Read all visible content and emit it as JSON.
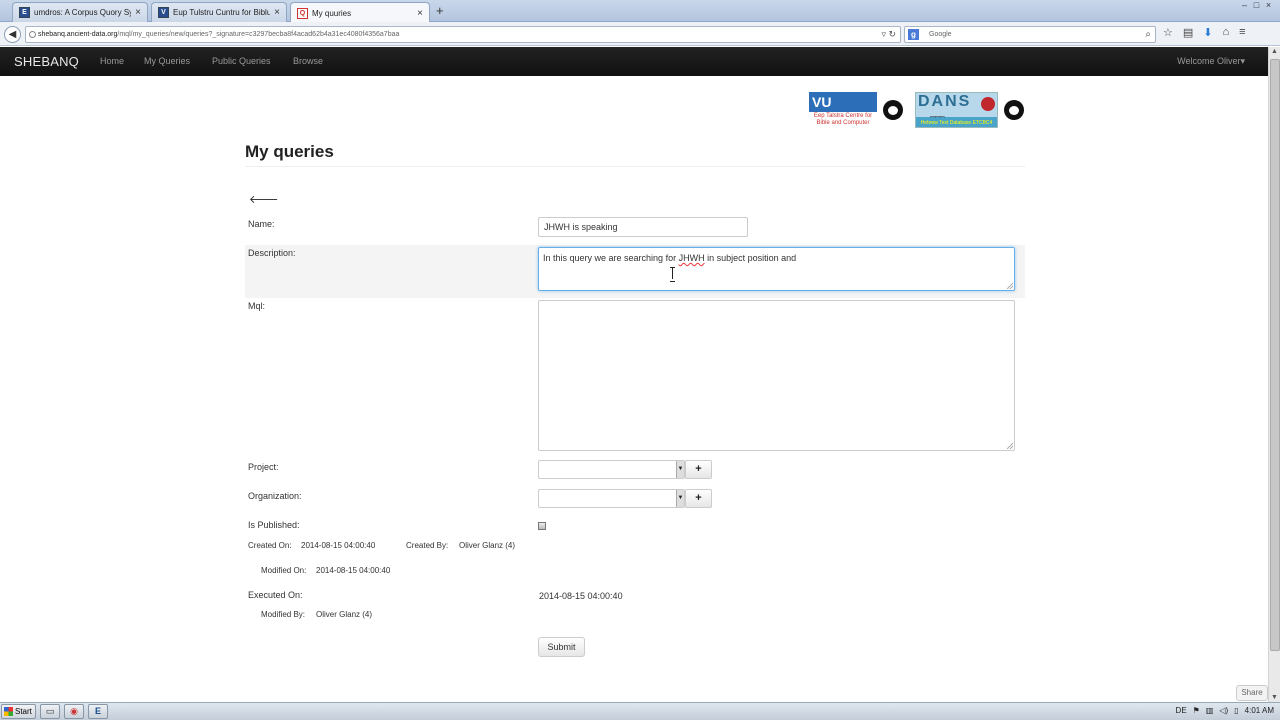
{
  "browser": {
    "tabs": [
      {
        "title": "umdros: A Corpus Quory Syst...",
        "favicon": "E"
      },
      {
        "title": "Eup Tulstru Cuntru for Biblu u...",
        "favicon": "V"
      },
      {
        "title": "My quuries",
        "favicon": "Q"
      }
    ],
    "url_host": "shebanq.ancient-data.org",
    "url_path": "/mql/my_queries/new/queries?_signature=c3297becba8f4acad62b4a31ec4080f4356a7baa",
    "search_placeholder": "Google",
    "search_engine_icon": "google-icon"
  },
  "site": {
    "brand": "SHEBANQ",
    "nav": [
      "Home",
      "My Queries",
      "Public Queries",
      "Browse"
    ],
    "welcome": "Welcome Oliver"
  },
  "logos": {
    "vu_text": "VU",
    "vu_caption": "Eep Talstra Centre for Bible and Computer",
    "dans_text": "DANS",
    "dans_caption": "Hebrew Text Database ETCBC4"
  },
  "page": {
    "title": "My queries",
    "back_icon": "left-arrow-icon"
  },
  "form": {
    "name_label": "Name:",
    "name_value": "JHWH is speaking",
    "description_label": "Description:",
    "description_before": "In this query we are searching for ",
    "description_misspelled": "JHWH",
    "description_after": " in subject position and",
    "mql_label": "Mql:",
    "mql_value": "",
    "project_label": "Project:",
    "organization_label": "Organization:",
    "is_published_label": "Is Published:",
    "is_published": false,
    "created_on_label": "Created On:",
    "created_on": "2014-08-15 04:00:40",
    "created_by_label": "Created By:",
    "created_by": "Oliver Glanz (4)",
    "modified_on_label": "Modified On:",
    "modified_on": "2014-08-15 04:00:40",
    "executed_on_label": "Executed On:",
    "executed_on": "2014-08-15 04:00:40",
    "modified_by_label": "Modified By:",
    "modified_by": "Oliver Glanz (4)",
    "add_label": "+",
    "submit_label": "Submit"
  },
  "share_label": "Share",
  "taskbar": {
    "start_label": "Start",
    "apps": [
      "folder-icon",
      "chrome-icon",
      "e-app-icon"
    ],
    "lang": "DE",
    "clock": "4:01 AM"
  },
  "colors": {
    "site_nav_bg": "#1b1b1b",
    "focus_border": "#66afe9",
    "desc_band_bg": "#f4f4f4"
  }
}
